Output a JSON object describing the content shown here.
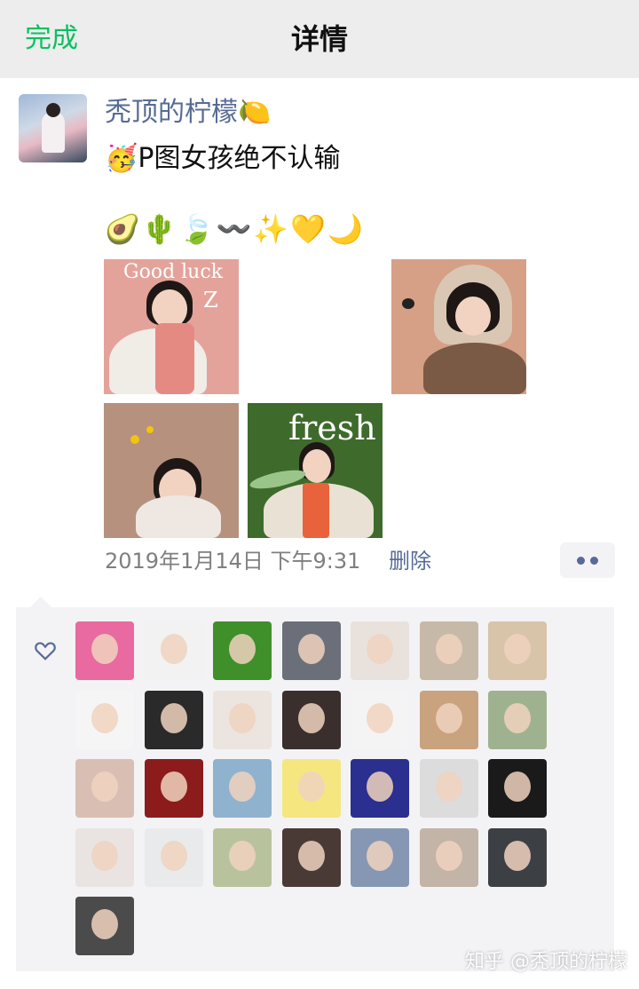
{
  "navbar": {
    "done_label": "完成",
    "title": "详情"
  },
  "post": {
    "username": "秃顶的柠檬🍋",
    "text": "🥳P图女孩绝不认输",
    "emojis": "🥑🌵🍃〰️✨💛🌙",
    "photos": [
      {
        "caption": "Good luck",
        "bg": "#e3a39b",
        "scribble": "Z"
      },
      {
        "caption": "",
        "bg": "#d6a086"
      },
      {
        "caption": "",
        "bg": "#b6917e"
      },
      {
        "caption": "fresh",
        "bg": "#3e6b2c"
      }
    ],
    "timestamp": "2019年1月14日 下午9:31",
    "delete_label": "删除"
  },
  "likes": {
    "icon": "heart-outline-icon",
    "avatars": [
      "#e86aa0",
      "#f2f2f2",
      "#3f8f2b",
      "#6b6f7a",
      "#e9e2dc",
      "#c7b9a8",
      "#d7c4a9",
      "#f5f5f5",
      "#2a2a2a",
      "#ece4df",
      "#3a2f2c",
      "#f4f4f4",
      "#c9a27e",
      "#9fb290",
      "#d9bfb3",
      "#8c1c1c",
      "#8fb2cf",
      "#f6e680",
      "#2b2f8f",
      "#dcdcdc",
      "#1a1a1a",
      "#e9e4e2",
      "#e9eaec",
      "#b8c39e",
      "#4a3a36",
      "#8697b3",
      "#c2b4a7",
      "#3c3f44",
      "#4b4b4b"
    ]
  },
  "watermark": "知乎 @秃顶的柠檬",
  "colors": {
    "accent": "#07c160",
    "link": "#576b95",
    "meta": "#7f7f7f"
  }
}
